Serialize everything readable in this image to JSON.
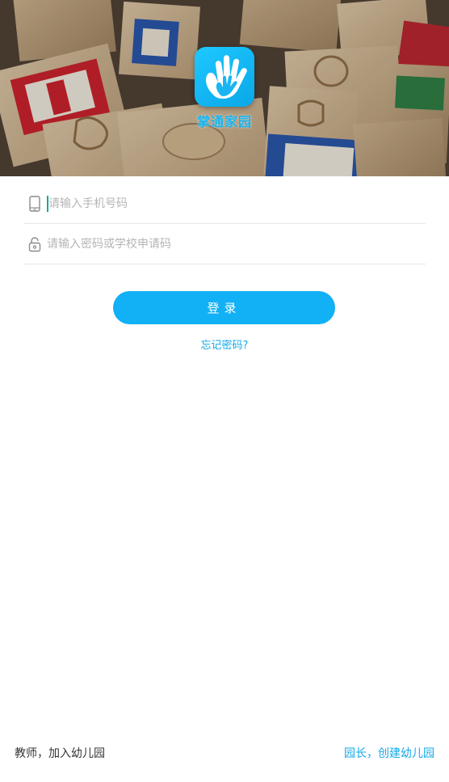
{
  "header": {
    "app_name": "掌通家园"
  },
  "login_form": {
    "phone_placeholder": "请输入手机号码",
    "phone_value": "",
    "password_placeholder": "请输入密码或学校申请码",
    "password_value": "",
    "login_label": "登录",
    "forgot_label": "忘记密码?"
  },
  "footer": {
    "teacher_join_label": "教师，加入幼儿园",
    "principal_create_label": "园长，创建幼儿园"
  },
  "colors": {
    "accent": "#12b0f5",
    "link": "#12a9e8",
    "cursor": "#1aa89a"
  },
  "icons": [
    "phone-icon",
    "lock-icon",
    "app-logo-hand-icon"
  ]
}
